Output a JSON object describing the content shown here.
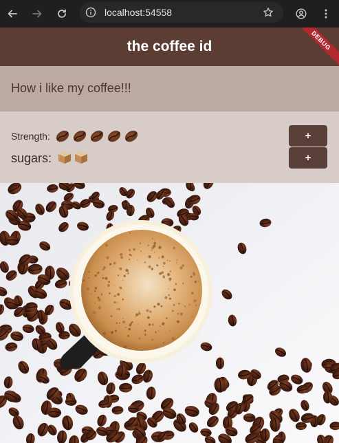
{
  "browser": {
    "url": "localhost:54558",
    "icons": [
      "back-arrow-icon",
      "forward-arrow-icon",
      "reload-icon",
      "site-info-icon",
      "bookmark-star-icon",
      "profile-icon",
      "menu-kebab-icon"
    ]
  },
  "appbar": {
    "title": "the coffee id",
    "debug_banner": "DEBUG",
    "color": "#5c3d34"
  },
  "headline": {
    "text": "How  i like my coffee!!!",
    "background": "#bca9a2"
  },
  "controls": {
    "strength_label": "Strength:",
    "strength_count": 5,
    "strength_icon": "coffee-bean-icon",
    "sugars_label": "sugars:",
    "sugars_count": 2,
    "sugar_icon": "sugar-cube-icon",
    "add_strength_label": "+",
    "add_sugar_label": "+",
    "background": "#d7ccc8"
  },
  "hero": {
    "image_icon": "coffee-cup-beans-image"
  }
}
